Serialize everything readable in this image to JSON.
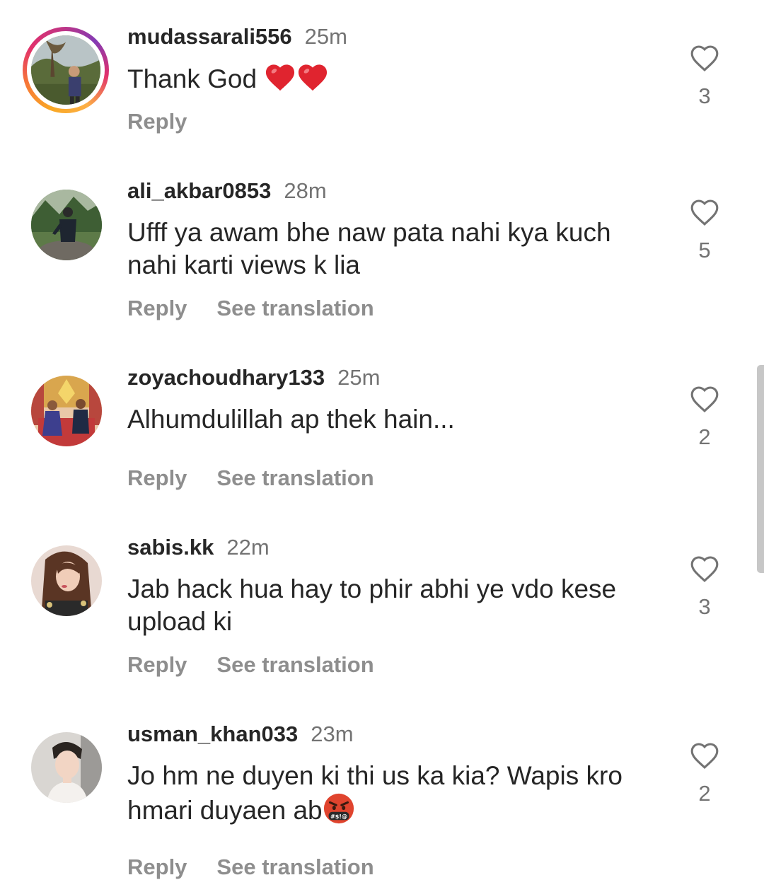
{
  "comments": [
    {
      "username": "mudassarali556",
      "time": "25m",
      "text": "Thank God ",
      "emoji": "red-heart-emoji",
      "emoji_count": 2,
      "reply_label": "Reply",
      "likes": "3",
      "has_story_ring": true
    },
    {
      "username": "ali_akbar0853",
      "time": "28m",
      "text": "Ufff ya awam bhe naw pata nahi kya kuch nahi karti views k lia",
      "reply_label": "Reply",
      "translate_label": "See translation",
      "likes": "5",
      "has_story_ring": false
    },
    {
      "username": "zoyachoudhary133",
      "time": "25m",
      "text": "Alhumdulillah ap thek hain...",
      "reply_label": "Reply",
      "translate_label": "See translation",
      "likes": "2",
      "has_story_ring": false
    },
    {
      "username": "sabis.kk",
      "time": "22m",
      "text": "Jab hack hua hay to phir abhi ye vdo kese upload ki",
      "reply_label": "Reply",
      "translate_label": "See translation",
      "likes": "3",
      "has_story_ring": false
    },
    {
      "username": "usman_khan033",
      "time": "23m",
      "text": "Jo hm ne duyen ki thi us ka kia? Wapis kro hmari duyaen ab",
      "emoji": "face-with-symbols-on-mouth-emoji",
      "reply_label": "Reply",
      "translate_label": "See translation",
      "likes": "2",
      "has_story_ring": false
    }
  ],
  "colors": {
    "text_primary": "#262626",
    "text_secondary": "#737373",
    "action_gray": "#8e8e8e",
    "heart_red": "#e0242f",
    "story_ring": [
      "#f9a825",
      "#f77737",
      "#e1306c",
      "#c13584",
      "#833ab4"
    ]
  }
}
